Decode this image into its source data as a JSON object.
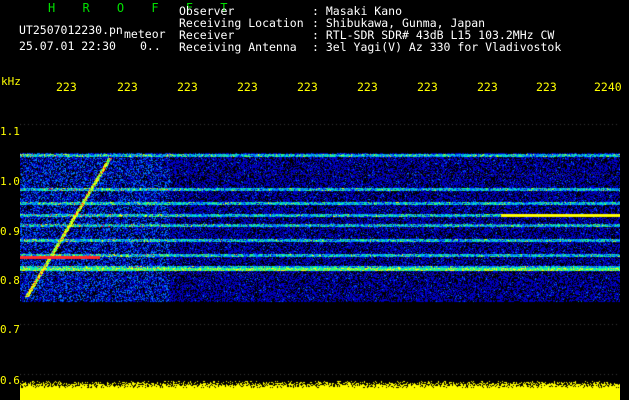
{
  "header": {
    "title": "H R O F F T",
    "filename": "UT2507012230.pn",
    "mode": "meteor",
    "datetime": "25.07.01 22:30",
    "state": "0..",
    "labels": [
      "Observer",
      "Receiving Location",
      "Receiver",
      "Receiving Antenna"
    ],
    "values": [
      ": Masaki Kano",
      ": Shibukawa, Gunma, Japan",
      ": RTL-SDR SDR# 43dB L15 103.2MHz CW",
      ": 3el Yagi(V) Az 330 for Vladivostok"
    ]
  },
  "axis": {
    "y_unit": "kHz",
    "y_ticks": [
      "1.1",
      "1.0",
      "0.9",
      "0.8",
      "0.7",
      "0.6"
    ],
    "x_ticks": [
      "223",
      "223",
      "223",
      "223",
      "223",
      "223",
      "223",
      "223",
      "223",
      "2240"
    ]
  },
  "colors": {
    "background": "#000000",
    "label_yellow": "#ffff00",
    "title_green": "#00e000"
  }
}
